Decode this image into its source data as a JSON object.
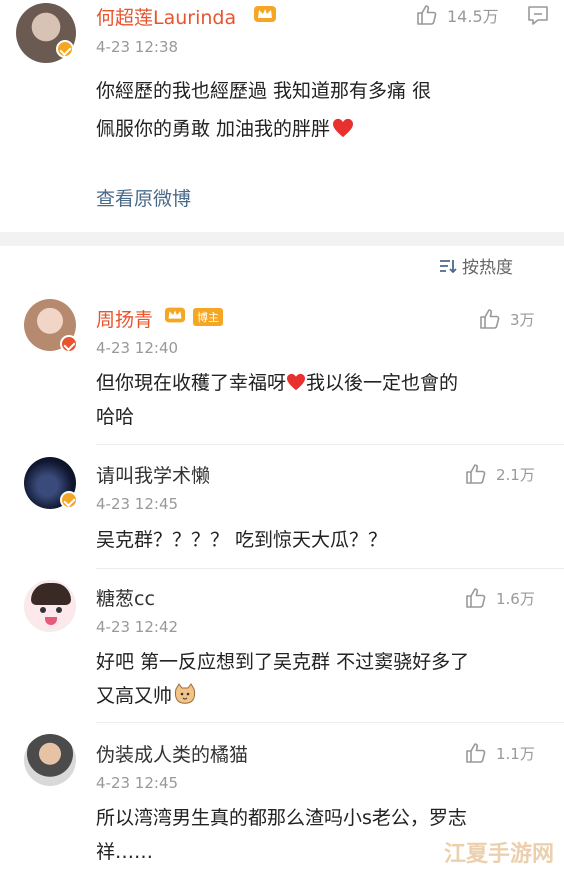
{
  "main_post": {
    "username": "何超莲Laurinda",
    "time": "4-23 12:38",
    "likes": "14.5万",
    "text_line1": "你經歷的我也經歷過 我知道那有多痛 很",
    "text_line2": "佩服你的勇敢 加油我的胖胖",
    "view_original": "查看原微博"
  },
  "sort": {
    "label": "按热度"
  },
  "comments": [
    {
      "username": "周扬青",
      "tag": "博主",
      "time": "4-23 12:40",
      "likes": "3万",
      "line1": "但你現在收穫了幸福呀",
      "line1b": "我以後一定也會的",
      "line2": "哈哈"
    },
    {
      "username": "请叫我学术懒",
      "time": "4-23 12:45",
      "likes": "2.1万",
      "line1": "吴克群？？？？ 吃到惊天大瓜？？"
    },
    {
      "username": "糖葱cc",
      "time": "4-23 12:42",
      "likes": "1.6万",
      "line1": "好吧 第一反应想到了吴克群 不过窦骁好多了",
      "line2": "又高又帅"
    },
    {
      "username": "伪装成人类的橘猫",
      "time": "4-23 12:45",
      "likes": "1.1万",
      "line1": "所以湾湾男生真的都那么渣吗小s老公，罗志",
      "line2": "祥……"
    }
  ],
  "watermark": "江夏手游网",
  "colors": {
    "accent": "#e8542d",
    "link": "#4a6a8a",
    "badge": "#f5a623"
  },
  "icons": [
    "thumb-up-icon",
    "comment-icon",
    "sort-icon",
    "crown-icon",
    "heart-icon",
    "verified-badge-icon"
  ]
}
